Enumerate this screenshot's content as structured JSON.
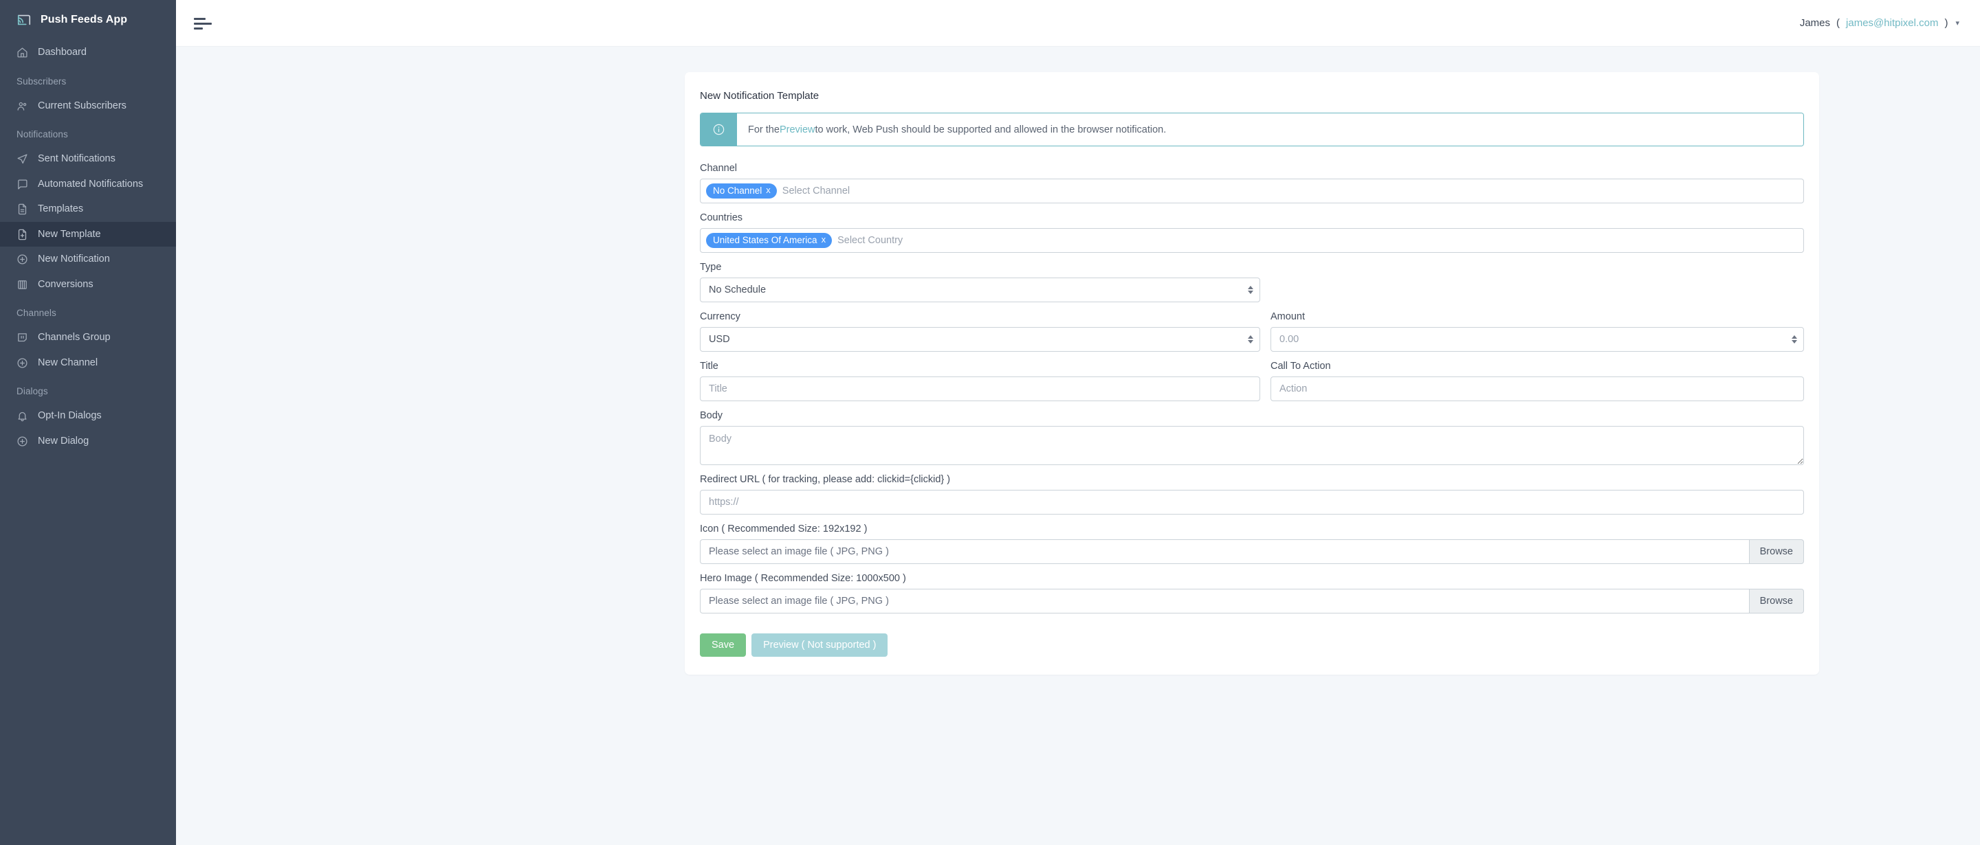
{
  "brand": {
    "name": "Push Feeds App",
    "logo_icon": "cast-feed-icon"
  },
  "sidebar": {
    "groups": [
      {
        "title": null,
        "items": [
          {
            "label": "Dashboard",
            "icon": "home-icon",
            "active": false
          }
        ]
      },
      {
        "title": "Subscribers",
        "items": [
          {
            "label": "Current Subscribers",
            "icon": "users-icon",
            "active": false
          }
        ]
      },
      {
        "title": "Notifications",
        "items": [
          {
            "label": "Sent Notifications",
            "icon": "send-icon",
            "active": false
          },
          {
            "label": "Automated Notifications",
            "icon": "message-square-icon",
            "active": false
          },
          {
            "label": "Templates",
            "icon": "file-text-icon",
            "active": false
          },
          {
            "label": "New Template",
            "icon": "file-plus-icon",
            "active": true
          },
          {
            "label": "New Notification",
            "icon": "plus-circle-icon",
            "active": false
          },
          {
            "label": "Conversions",
            "icon": "columns-icon",
            "active": false
          }
        ]
      },
      {
        "title": "Channels",
        "items": [
          {
            "label": "Channels Group",
            "icon": "channel-icon",
            "active": false
          },
          {
            "label": "New Channel",
            "icon": "plus-circle-icon",
            "active": false
          }
        ]
      },
      {
        "title": "Dialogs",
        "items": [
          {
            "label": "Opt-In Dialogs",
            "icon": "bell-icon",
            "active": false
          },
          {
            "label": "New Dialog",
            "icon": "plus-circle-icon",
            "active": false
          }
        ]
      }
    ]
  },
  "topbar": {
    "menu_icon": "hamburger-icon",
    "user_name": "James",
    "user_paren_open": "(",
    "user_email": "james@hitpixel.com",
    "user_paren_close": ")",
    "caret_icon": "chevron-down-icon"
  },
  "card": {
    "title": "New Notification Template",
    "alert": {
      "icon": "info-circle-icon",
      "text_before": "For the ",
      "link_text": "Preview",
      "text_after": " to work, Web Push should be supported and allowed in the browser notification."
    },
    "fields": {
      "channel": {
        "label": "Channel",
        "token": "No Channel",
        "token_remove": "x",
        "placeholder": "Select Channel"
      },
      "countries": {
        "label": "Countries",
        "token": "United States Of America",
        "token_remove": "x",
        "placeholder": "Select Country"
      },
      "type": {
        "label": "Type",
        "value": "No Schedule",
        "options": [
          "No Schedule"
        ]
      },
      "currency": {
        "label": "Currency",
        "value": "USD",
        "options": [
          "USD"
        ]
      },
      "amount": {
        "label": "Amount",
        "placeholder": "0.00",
        "value": ""
      },
      "title": {
        "label": "Title",
        "placeholder": "Title",
        "value": ""
      },
      "call_to_action": {
        "label": "Call To Action",
        "placeholder": "Action",
        "value": ""
      },
      "body": {
        "label": "Body",
        "placeholder": "Body",
        "value": ""
      },
      "redirect_url": {
        "label": "Redirect URL ( for tracking, please add: clickid={clickid} )",
        "placeholder": "https://",
        "value": ""
      },
      "icon_upload": {
        "label": "Icon ( Recommended Size: 192x192 )",
        "filename": "Please select an image file ( JPG, PNG )",
        "browse": "Browse"
      },
      "hero_upload": {
        "label": "Hero Image ( Recommended Size: 1000x500 )",
        "filename": "Please select an image file ( JPG, PNG )",
        "browse": "Browse"
      }
    },
    "actions": {
      "save": "Save",
      "preview": "Preview ( Not supported )"
    }
  },
  "colors": {
    "sidebar_bg": "#3c4758",
    "sidebar_active": "#2e3849",
    "page_bg": "#f4f7fa",
    "accent_teal": "#6cb8c2",
    "token_blue": "#4a97f7",
    "save_green": "#76c487",
    "preview_disabled": "#a5d4da"
  }
}
